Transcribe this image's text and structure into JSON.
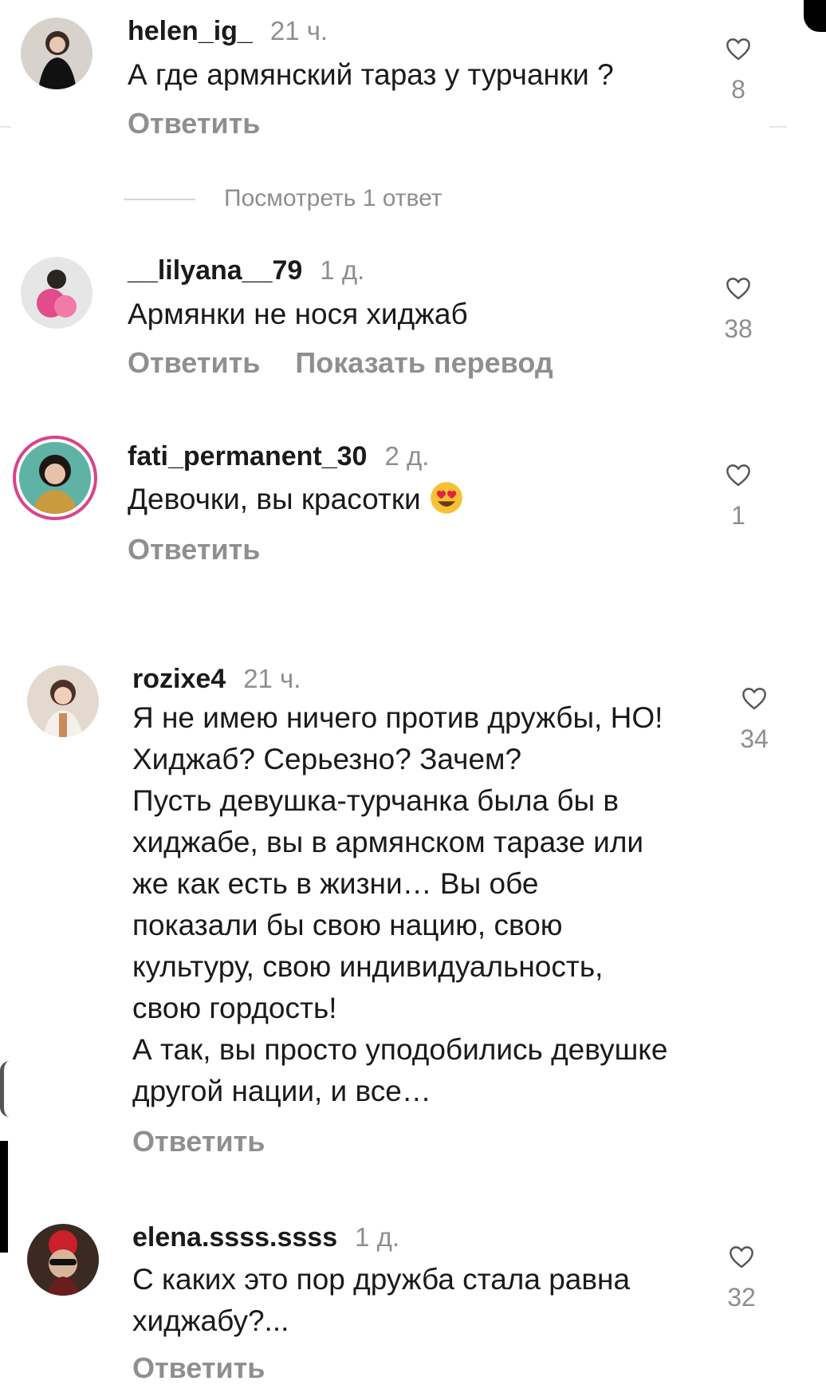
{
  "comments": [
    {
      "username": "helen_ig_",
      "time": "21 ч.",
      "text": "А где армянский тараз у турчанки ?",
      "actions": [
        "Ответить"
      ],
      "likes": "8",
      "view_replies": "Посмотреть 1 ответ"
    },
    {
      "username": "__lilyana__79",
      "time": "1 д.",
      "text": "Армянки не нося хиджаб",
      "actions": [
        "Ответить",
        "Показать перевод"
      ],
      "likes": "38"
    },
    {
      "username": "fati_permanent_30",
      "time": "2 д.",
      "text": "Девочки, вы красотки",
      "actions": [
        "Ответить"
      ],
      "likes": "1"
    },
    {
      "username": "rozixe4",
      "time": "21 ч.",
      "text": "Я не имею ничего против дружбы, НО!\nХиджаб? Серьезно? Зачем?\nПусть девушка-турчанка была бы в\nхиджабе, вы в армянском таразе или\nже как есть в жизни… Вы обе\nпоказали бы свою нацию, свою\nкультуру, свою индивидуальность,\nсвою гордость!\nА так, вы просто уподобились девушке\nдругой нации, и все…",
      "actions": [
        "Ответить"
      ],
      "likes": "34"
    },
    {
      "username": "elena.ssss.ssss",
      "time": "1 д.",
      "text": "С каких это пор дружба стала равна\nхиджабу?...",
      "actions": [
        "Ответить"
      ],
      "likes": "32"
    }
  ],
  "icons": {
    "like": "heart-outline-icon",
    "emoji": "heart-eyes-emoji"
  },
  "colors": {
    "text": "#1a1a1a",
    "secondary": "#8e8e8e",
    "story_ring": "#d9438b"
  }
}
